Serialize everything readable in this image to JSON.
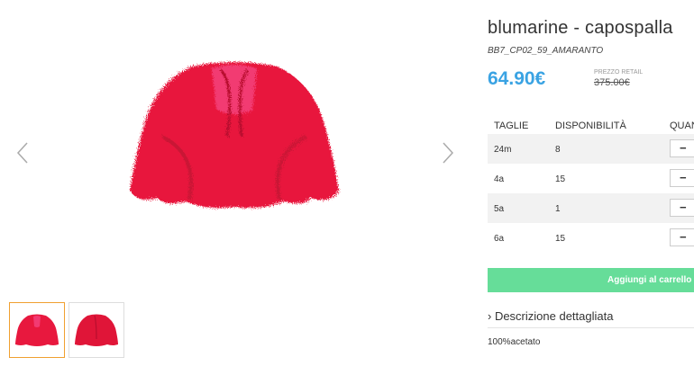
{
  "product": {
    "title": "blumarine - capospalla",
    "sku": "BB7_CP02_59_AMARANTO",
    "price": "64.90€",
    "retail_label": "PREZZO RETAIL",
    "retail_price": "375.00€",
    "color": "#e8183e"
  },
  "sizes": {
    "headers": {
      "size": "TAGLIE",
      "availability": "DISPONIBILITÀ",
      "quantity": "QUANTITÀ"
    },
    "rows": [
      {
        "size": "24m",
        "qty": "8",
        "minus": "−"
      },
      {
        "size": "4a",
        "qty": "15",
        "minus": "−"
      },
      {
        "size": "5a",
        "qty": "1",
        "minus": "−"
      },
      {
        "size": "6a",
        "qty": "15",
        "minus": "−"
      }
    ]
  },
  "actions": {
    "add_to_cart": "Aggiungi al carrello",
    "description_toggle": "› Descrizione dettagliata"
  },
  "description": "100%acetato",
  "gallery": {
    "prev_icon": "chevron-left-icon",
    "next_icon": "chevron-right-icon"
  }
}
